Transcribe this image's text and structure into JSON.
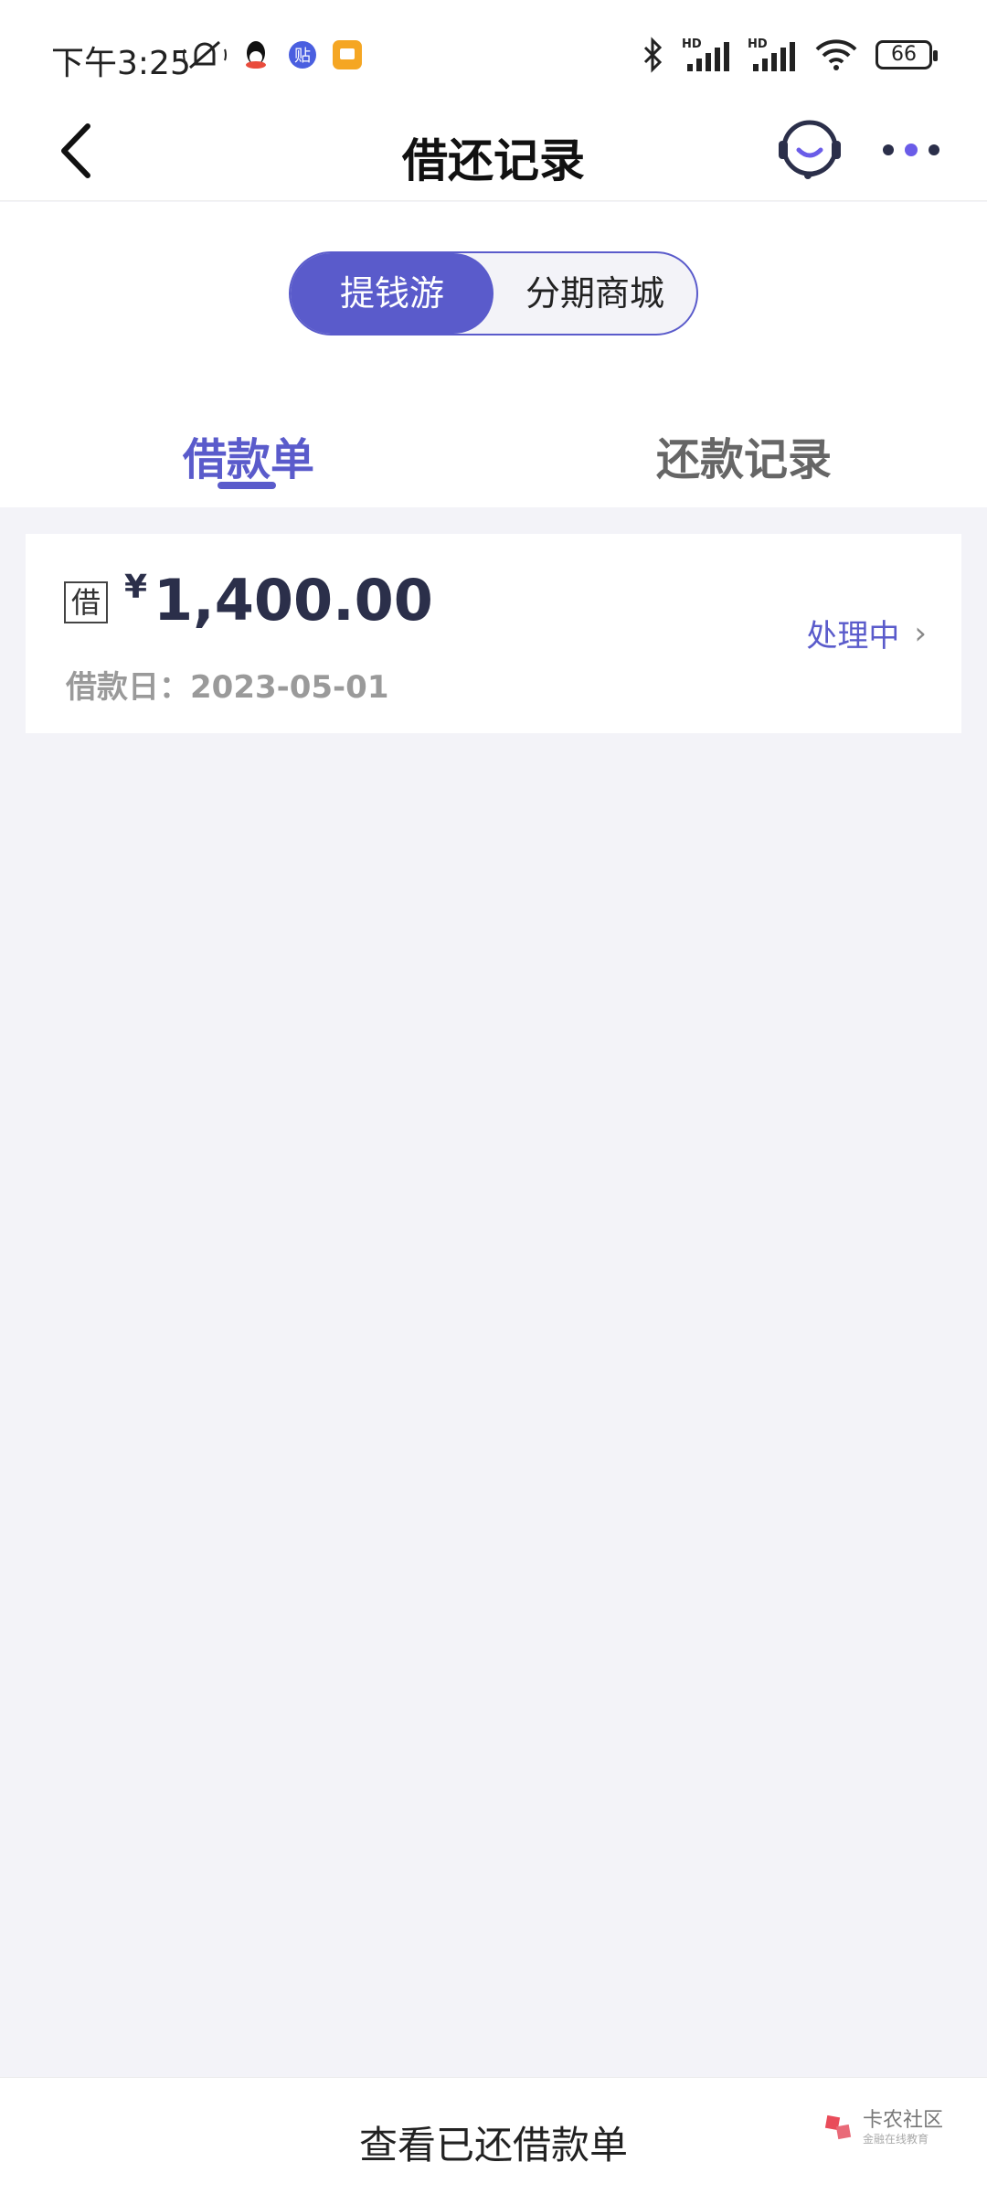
{
  "status_bar": {
    "time": "下午3:25",
    "battery": "66",
    "signal_label_1": "HD",
    "signal_label_2": "HD"
  },
  "header": {
    "title": "借还记录"
  },
  "segment": {
    "options": [
      "提钱游",
      "分期商城"
    ],
    "active_index": 0
  },
  "tabs": {
    "items": [
      "借款单",
      "还款记录"
    ],
    "active_index": 0
  },
  "loan_card": {
    "tag": "借",
    "currency": "¥",
    "amount": "1,400.00",
    "date_label": "借款日：2023-05-01",
    "status": "处理中"
  },
  "footer": {
    "button_label": "查看已还借款单",
    "watermark": "卡农社区",
    "watermark_sub": "金融在线教育"
  },
  "colors": {
    "accent": "#5a5bcb",
    "background": "#f3f3f8"
  }
}
